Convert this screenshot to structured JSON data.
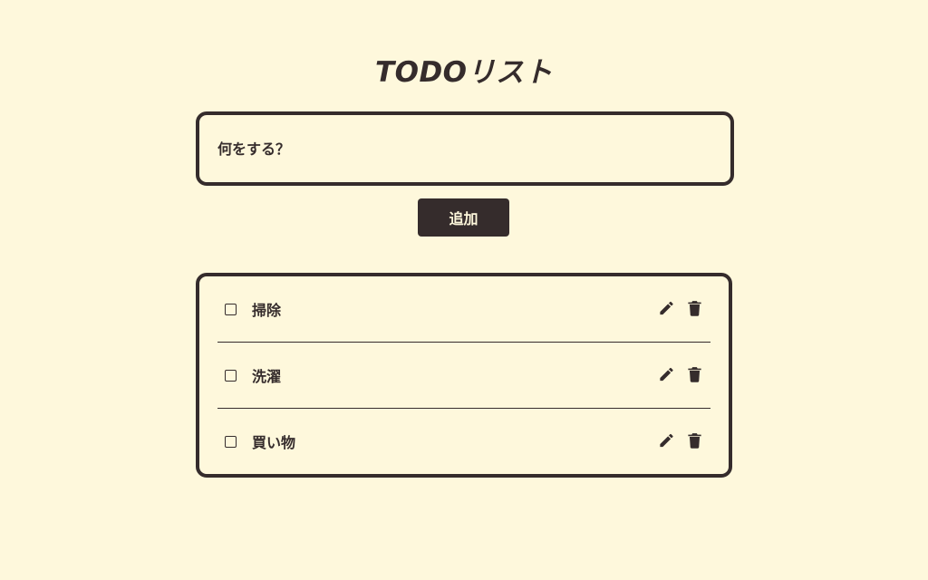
{
  "header": {
    "title": "TODOリスト"
  },
  "new_todo": {
    "placeholder": "何をする？",
    "value": ""
  },
  "add_button": {
    "label": "追加"
  },
  "todos": [
    {
      "label": "掃除",
      "done": false
    },
    {
      "label": "洗濯",
      "done": false
    },
    {
      "label": "買い物",
      "done": false
    }
  ],
  "icons": {
    "edit": "pencil-icon",
    "delete": "trash-icon"
  },
  "colors": {
    "background": "#fef8dc",
    "ink": "#352c2c"
  }
}
